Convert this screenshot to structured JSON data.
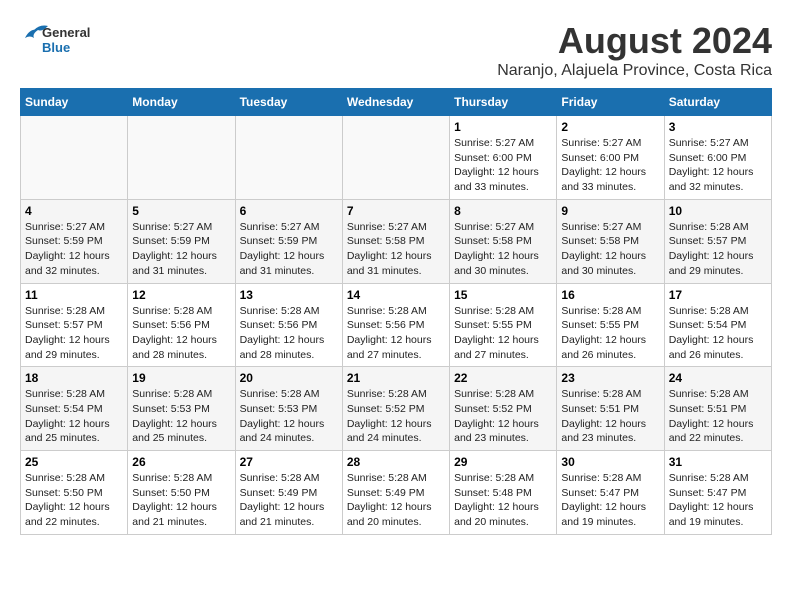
{
  "header": {
    "logo_line1": "General",
    "logo_line2": "Blue",
    "title": "August 2024",
    "subtitle": "Naranjo, Alajuela Province, Costa Rica"
  },
  "calendar": {
    "days_of_week": [
      "Sunday",
      "Monday",
      "Tuesday",
      "Wednesday",
      "Thursday",
      "Friday",
      "Saturday"
    ],
    "weeks": [
      [
        {
          "num": "",
          "info": ""
        },
        {
          "num": "",
          "info": ""
        },
        {
          "num": "",
          "info": ""
        },
        {
          "num": "",
          "info": ""
        },
        {
          "num": "1",
          "info": "Sunrise: 5:27 AM\nSunset: 6:00 PM\nDaylight: 12 hours\nand 33 minutes."
        },
        {
          "num": "2",
          "info": "Sunrise: 5:27 AM\nSunset: 6:00 PM\nDaylight: 12 hours\nand 33 minutes."
        },
        {
          "num": "3",
          "info": "Sunrise: 5:27 AM\nSunset: 6:00 PM\nDaylight: 12 hours\nand 32 minutes."
        }
      ],
      [
        {
          "num": "4",
          "info": "Sunrise: 5:27 AM\nSunset: 5:59 PM\nDaylight: 12 hours\nand 32 minutes."
        },
        {
          "num": "5",
          "info": "Sunrise: 5:27 AM\nSunset: 5:59 PM\nDaylight: 12 hours\nand 31 minutes."
        },
        {
          "num": "6",
          "info": "Sunrise: 5:27 AM\nSunset: 5:59 PM\nDaylight: 12 hours\nand 31 minutes."
        },
        {
          "num": "7",
          "info": "Sunrise: 5:27 AM\nSunset: 5:58 PM\nDaylight: 12 hours\nand 31 minutes."
        },
        {
          "num": "8",
          "info": "Sunrise: 5:27 AM\nSunset: 5:58 PM\nDaylight: 12 hours\nand 30 minutes."
        },
        {
          "num": "9",
          "info": "Sunrise: 5:27 AM\nSunset: 5:58 PM\nDaylight: 12 hours\nand 30 minutes."
        },
        {
          "num": "10",
          "info": "Sunrise: 5:28 AM\nSunset: 5:57 PM\nDaylight: 12 hours\nand 29 minutes."
        }
      ],
      [
        {
          "num": "11",
          "info": "Sunrise: 5:28 AM\nSunset: 5:57 PM\nDaylight: 12 hours\nand 29 minutes."
        },
        {
          "num": "12",
          "info": "Sunrise: 5:28 AM\nSunset: 5:56 PM\nDaylight: 12 hours\nand 28 minutes."
        },
        {
          "num": "13",
          "info": "Sunrise: 5:28 AM\nSunset: 5:56 PM\nDaylight: 12 hours\nand 28 minutes."
        },
        {
          "num": "14",
          "info": "Sunrise: 5:28 AM\nSunset: 5:56 PM\nDaylight: 12 hours\nand 27 minutes."
        },
        {
          "num": "15",
          "info": "Sunrise: 5:28 AM\nSunset: 5:55 PM\nDaylight: 12 hours\nand 27 minutes."
        },
        {
          "num": "16",
          "info": "Sunrise: 5:28 AM\nSunset: 5:55 PM\nDaylight: 12 hours\nand 26 minutes."
        },
        {
          "num": "17",
          "info": "Sunrise: 5:28 AM\nSunset: 5:54 PM\nDaylight: 12 hours\nand 26 minutes."
        }
      ],
      [
        {
          "num": "18",
          "info": "Sunrise: 5:28 AM\nSunset: 5:54 PM\nDaylight: 12 hours\nand 25 minutes."
        },
        {
          "num": "19",
          "info": "Sunrise: 5:28 AM\nSunset: 5:53 PM\nDaylight: 12 hours\nand 25 minutes."
        },
        {
          "num": "20",
          "info": "Sunrise: 5:28 AM\nSunset: 5:53 PM\nDaylight: 12 hours\nand 24 minutes."
        },
        {
          "num": "21",
          "info": "Sunrise: 5:28 AM\nSunset: 5:52 PM\nDaylight: 12 hours\nand 24 minutes."
        },
        {
          "num": "22",
          "info": "Sunrise: 5:28 AM\nSunset: 5:52 PM\nDaylight: 12 hours\nand 23 minutes."
        },
        {
          "num": "23",
          "info": "Sunrise: 5:28 AM\nSunset: 5:51 PM\nDaylight: 12 hours\nand 23 minutes."
        },
        {
          "num": "24",
          "info": "Sunrise: 5:28 AM\nSunset: 5:51 PM\nDaylight: 12 hours\nand 22 minutes."
        }
      ],
      [
        {
          "num": "25",
          "info": "Sunrise: 5:28 AM\nSunset: 5:50 PM\nDaylight: 12 hours\nand 22 minutes."
        },
        {
          "num": "26",
          "info": "Sunrise: 5:28 AM\nSunset: 5:50 PM\nDaylight: 12 hours\nand 21 minutes."
        },
        {
          "num": "27",
          "info": "Sunrise: 5:28 AM\nSunset: 5:49 PM\nDaylight: 12 hours\nand 21 minutes."
        },
        {
          "num": "28",
          "info": "Sunrise: 5:28 AM\nSunset: 5:49 PM\nDaylight: 12 hours\nand 20 minutes."
        },
        {
          "num": "29",
          "info": "Sunrise: 5:28 AM\nSunset: 5:48 PM\nDaylight: 12 hours\nand 20 minutes."
        },
        {
          "num": "30",
          "info": "Sunrise: 5:28 AM\nSunset: 5:47 PM\nDaylight: 12 hours\nand 19 minutes."
        },
        {
          "num": "31",
          "info": "Sunrise: 5:28 AM\nSunset: 5:47 PM\nDaylight: 12 hours\nand 19 minutes."
        }
      ]
    ]
  }
}
